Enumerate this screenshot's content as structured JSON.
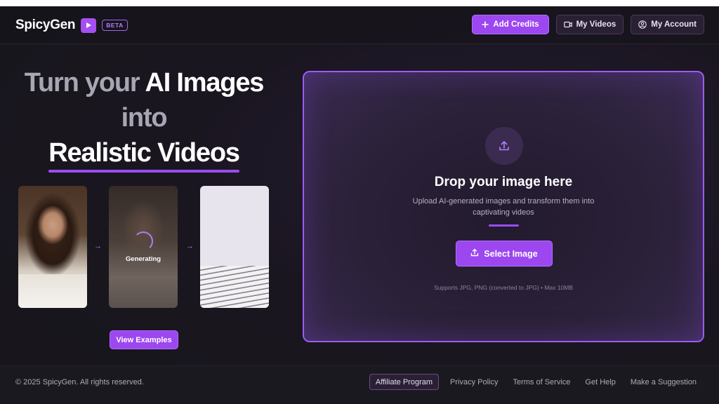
{
  "header": {
    "logo_text": "SpicyGen",
    "beta_badge": "BETA",
    "nav": {
      "add_credits": "Add Credits",
      "my_videos": "My Videos",
      "my_account": "My Account"
    }
  },
  "hero": {
    "line1_grey": "Turn your",
    "line1_white": "AI Images",
    "line2": "into",
    "line3": "Realistic Videos"
  },
  "samples": {
    "generating_label": "Generating",
    "view_examples": "View Examples"
  },
  "dropzone": {
    "title": "Drop your image here",
    "subtitle": "Upload AI-generated images and transform them into captivating videos",
    "select_button": "Select Image",
    "supports": "Supports JPG, PNG (converted to JPG) • Max 10MB"
  },
  "footer": {
    "copyright": "© 2025 SpicyGen. All rights reserved.",
    "links": [
      "Affiliate Program",
      "Privacy Policy",
      "Terms of Service",
      "Get Help",
      "Make a Suggestion"
    ]
  },
  "colors": {
    "accent": "#9c47f0",
    "background": "#17151b"
  }
}
